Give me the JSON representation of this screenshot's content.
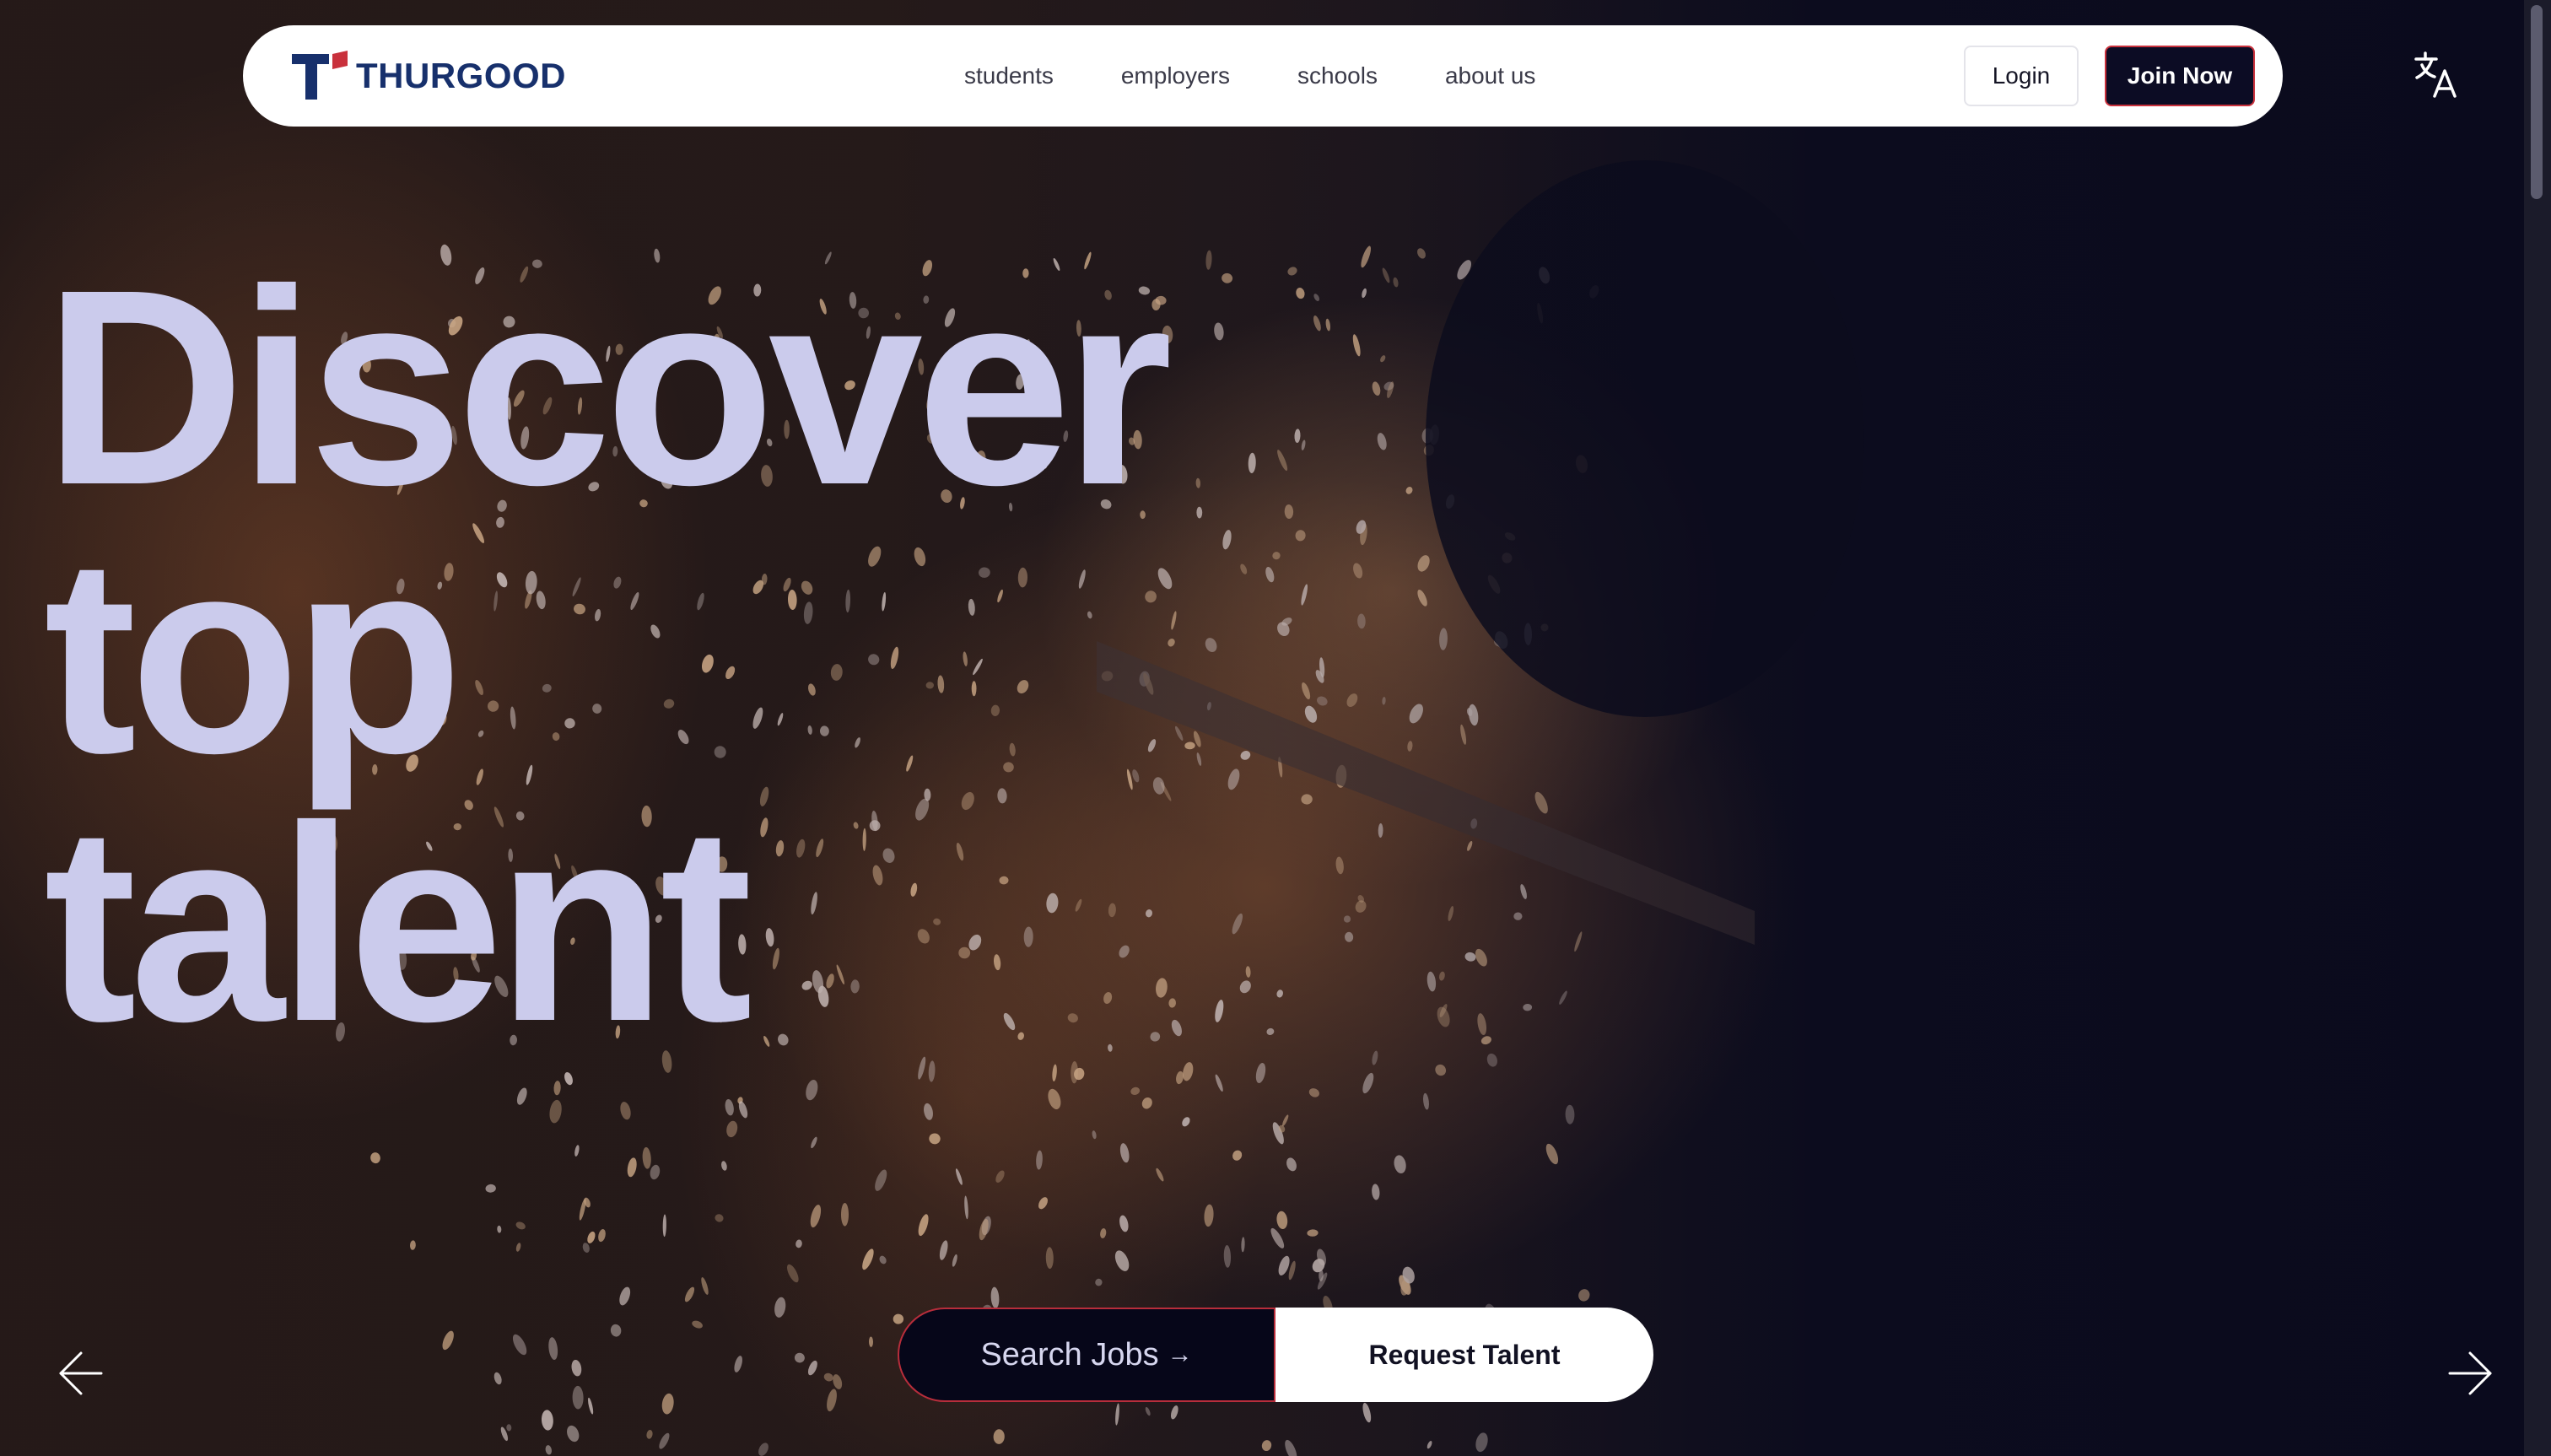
{
  "brand": {
    "name": "THURGOOD",
    "colors": {
      "navy": "#17306c",
      "red": "#c9313c"
    }
  },
  "nav": {
    "links": [
      "students",
      "employers",
      "schools",
      "about us"
    ],
    "login_label": "Login",
    "join_label": "Join Now",
    "translate_icon": "translate-icon"
  },
  "hero": {
    "headline_lines": [
      "Discover",
      "top",
      "talent"
    ],
    "headline_color": "#cbcbec",
    "search_label": "Search Jobs",
    "search_arrow": "→",
    "request_label": "Request Talent",
    "prev_icon": "arrow-left-icon",
    "next_icon": "arrow-right-icon"
  }
}
